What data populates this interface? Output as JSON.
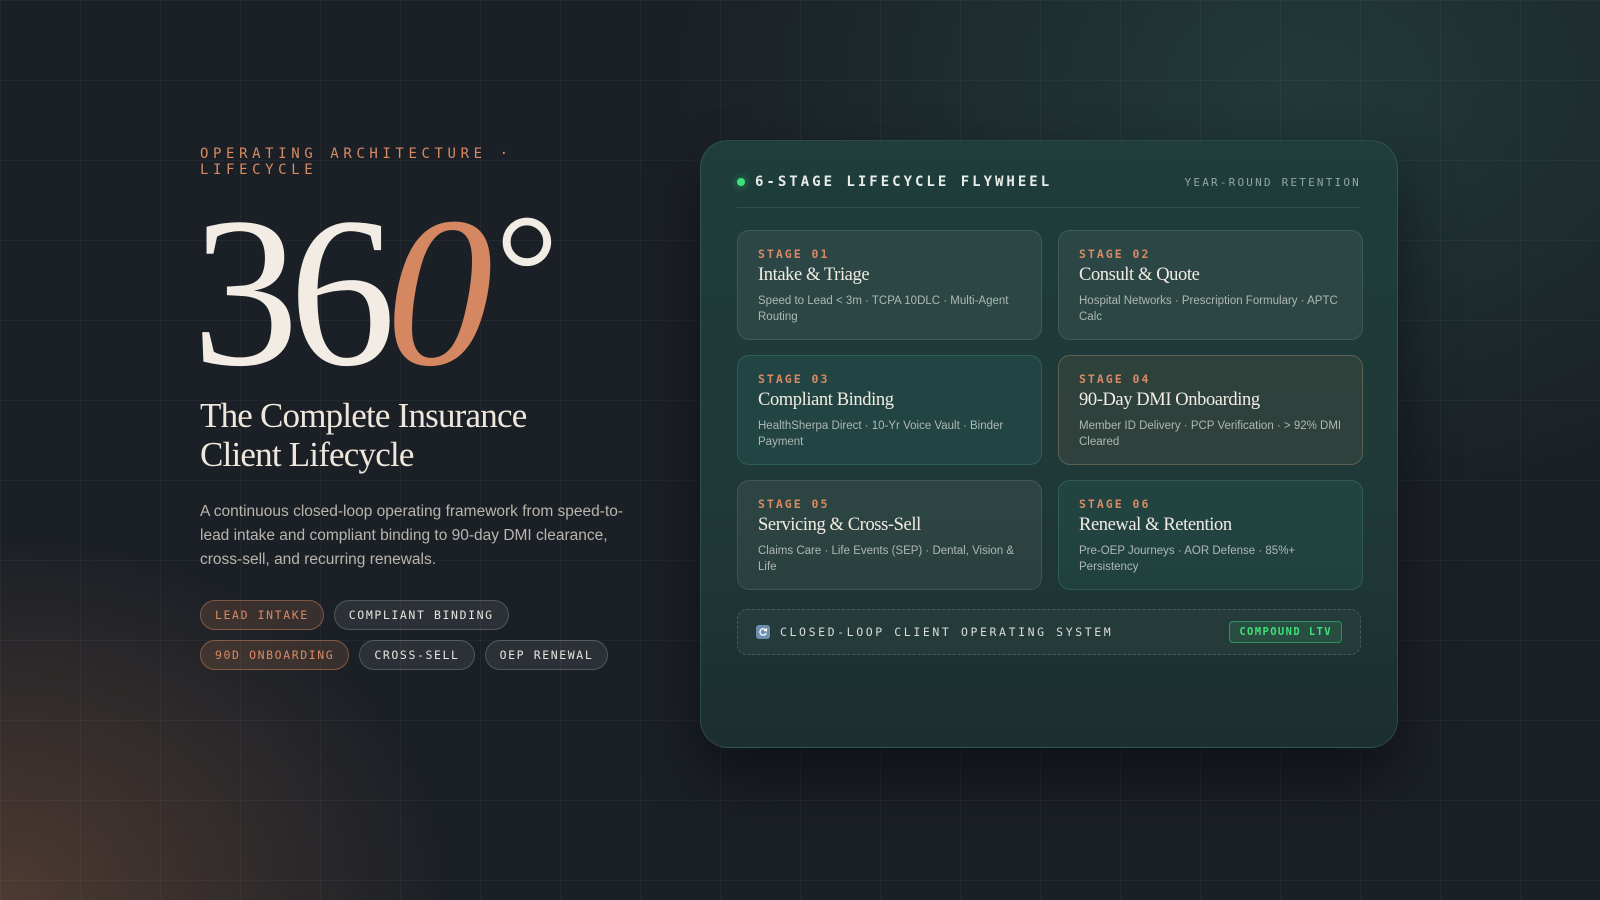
{
  "hero": {
    "eyebrow": "OPERATING ARCHITECTURE · LIFECYCLE",
    "big_number_main": "36",
    "big_number_accent": "0",
    "big_number_unit": "°",
    "headline": "The Complete Insurance Client Lifecycle",
    "description": "A continuous closed-loop operating framework from speed-to-lead intake and compliant binding to 90-day DMI clearance, cross-sell, and recurring renewals.",
    "pills": [
      {
        "label": "LEAD INTAKE",
        "style": "warm"
      },
      {
        "label": "COMPLIANT BINDING",
        "style": "neutral"
      },
      {
        "label": "90D ONBOARDING",
        "style": "warm"
      },
      {
        "label": "CROSS-SELL",
        "style": "neutral"
      },
      {
        "label": "OEP RENEWAL",
        "style": "neutral"
      }
    ]
  },
  "panel": {
    "title": "6-STAGE LIFECYCLE FLYWHEEL",
    "subtitle": "YEAR-ROUND RETENTION",
    "status_color": "#3ee07a",
    "stages": [
      {
        "num": "STAGE 01",
        "name": "Intake & Triage",
        "detail": "Speed to Lead < 3m · TCPA 10DLC · Multi-Agent Routing"
      },
      {
        "num": "STAGE 02",
        "name": "Consult & Quote",
        "detail": "Hospital Networks · Prescription Formulary · APTC Calc"
      },
      {
        "num": "STAGE 03",
        "name": "Compliant Binding",
        "detail": "HealthSherpa Direct · 10-Yr Voice Vault · Binder Payment"
      },
      {
        "num": "STAGE 04",
        "name": "90-Day DMI Onboarding",
        "detail": "Member ID Delivery · PCP Verification · > 92% DMI Cleared"
      },
      {
        "num": "STAGE 05",
        "name": "Servicing & Cross-Sell",
        "detail": "Claims Care · Life Events (SEP) · Dental, Vision & Life"
      },
      {
        "num": "STAGE 06",
        "name": "Renewal & Retention",
        "detail": "Pre-OEP Journeys · AOR Defense · 85%+ Persistency"
      }
    ],
    "footer": {
      "icon": "cycle-icon",
      "label": "CLOSED-LOOP CLIENT OPERATING SYSTEM",
      "badge": "COMPOUND LTV"
    }
  },
  "colors": {
    "accent_copper": "#d48760",
    "accent_green": "#3ee07a",
    "background": "#1b2026"
  }
}
